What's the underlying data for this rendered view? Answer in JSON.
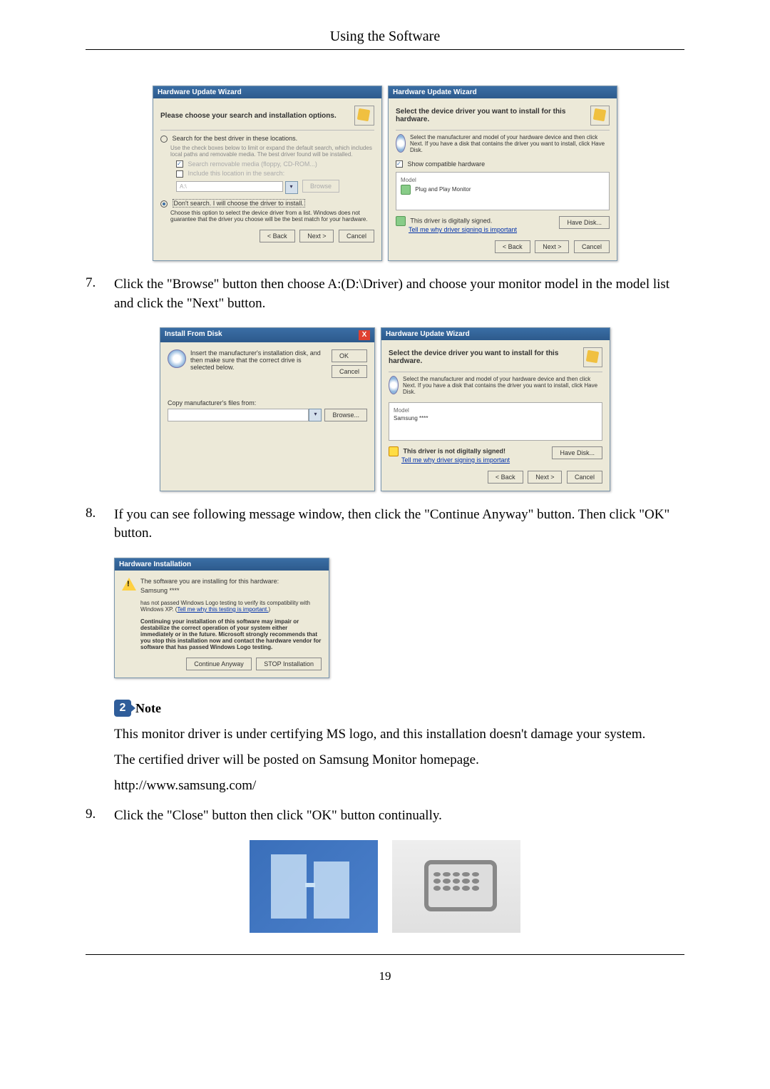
{
  "header": {
    "title": "Using the Software"
  },
  "dlg1": {
    "title": "Hardware Update Wizard",
    "heading": "Please choose your search and installation options.",
    "opt1_label": "Search for the best driver in these locations.",
    "opt1_desc": "Use the check boxes below to limit or expand the default search, which includes local paths and removable media. The best driver found will be installed.",
    "chk1": "Search removable media (floppy, CD-ROM...)",
    "chk2": "Include this location in the search:",
    "path_placeholder": "A:\\",
    "browse_btn": "Browse",
    "opt2_label": "Don't search. I will choose the driver to install.",
    "opt2_desc": "Choose this option to select the device driver from a list. Windows does not guarantee that the driver you choose will be the best match for your hardware.",
    "back": "< Back",
    "next": "Next >",
    "cancel": "Cancel"
  },
  "dlg2": {
    "title": "Hardware Update Wizard",
    "heading": "Select the device driver you want to install for this hardware.",
    "desc": "Select the manufacturer and model of your hardware device and then click Next. If you have a disk that contains the driver you want to install, click Have Disk.",
    "chk_compat": "Show compatible hardware",
    "model_label": "Model",
    "model_item": "Plug and Play Monitor",
    "signed": "This driver is digitally signed.",
    "tell_me": "Tell me why driver signing is important",
    "have_disk": "Have Disk...",
    "back": "< Back",
    "next": "Next >",
    "cancel": "Cancel"
  },
  "step7": {
    "num": "7.",
    "text": "Click the \"Browse\" button then choose A:(D:\\Driver) and choose your monitor model in the model list and click the \"Next\" button."
  },
  "dlg3": {
    "title": "Install From Disk",
    "desc": "Insert the manufacturer's installation disk, and then make sure that the correct drive is selected below.",
    "ok": "OK",
    "cancel": "Cancel",
    "copy_label": "Copy manufacturer's files from:",
    "browse": "Browse..."
  },
  "dlg4": {
    "title": "Hardware Update Wizard",
    "heading": "Select the device driver you want to install for this hardware.",
    "desc": "Select the manufacturer and model of your hardware device and then click Next. If you have a disk that contains the driver you want to install, click Have Disk.",
    "model_label": "Model",
    "model_item": "Samsung ****",
    "not_signed": "This driver is not digitally signed!",
    "tell_me": "Tell me why driver signing is important",
    "have_disk": "Have Disk...",
    "back": "< Back",
    "next": "Next >",
    "cancel": "Cancel"
  },
  "step8": {
    "num": "8.",
    "text": "If you can see following message window, then click the \"Continue Anyway\" button. Then click \"OK\" button."
  },
  "dlg5": {
    "title": "Hardware Installation",
    "line1": "The software you are installing for this hardware:",
    "line2": "Samsung ****",
    "line3": "has not passed Windows Logo testing to verify its compatibility with Windows XP. (",
    "link3": "Tell me why this testing is important.",
    "line3b": ")",
    "bold": "Continuing your installation of this software may impair or destabilize the correct operation of your system either immediately or in the future. Microsoft strongly recommends that you stop this installation now and contact the hardware vendor for software that has passed Windows Logo testing.",
    "continue": "Continue Anyway",
    "stop": "STOP Installation"
  },
  "note": {
    "label": "Note",
    "p1": "This monitor driver is under certifying MS logo, and this installation doesn't damage your system.",
    "p2": "The certified driver will be posted on Samsung Monitor homepage.",
    "p3": "http://www.samsung.com/"
  },
  "step9": {
    "num": "9.",
    "text": "Click the \"Close\" button then click \"OK\" button continually."
  },
  "page_num": "19"
}
